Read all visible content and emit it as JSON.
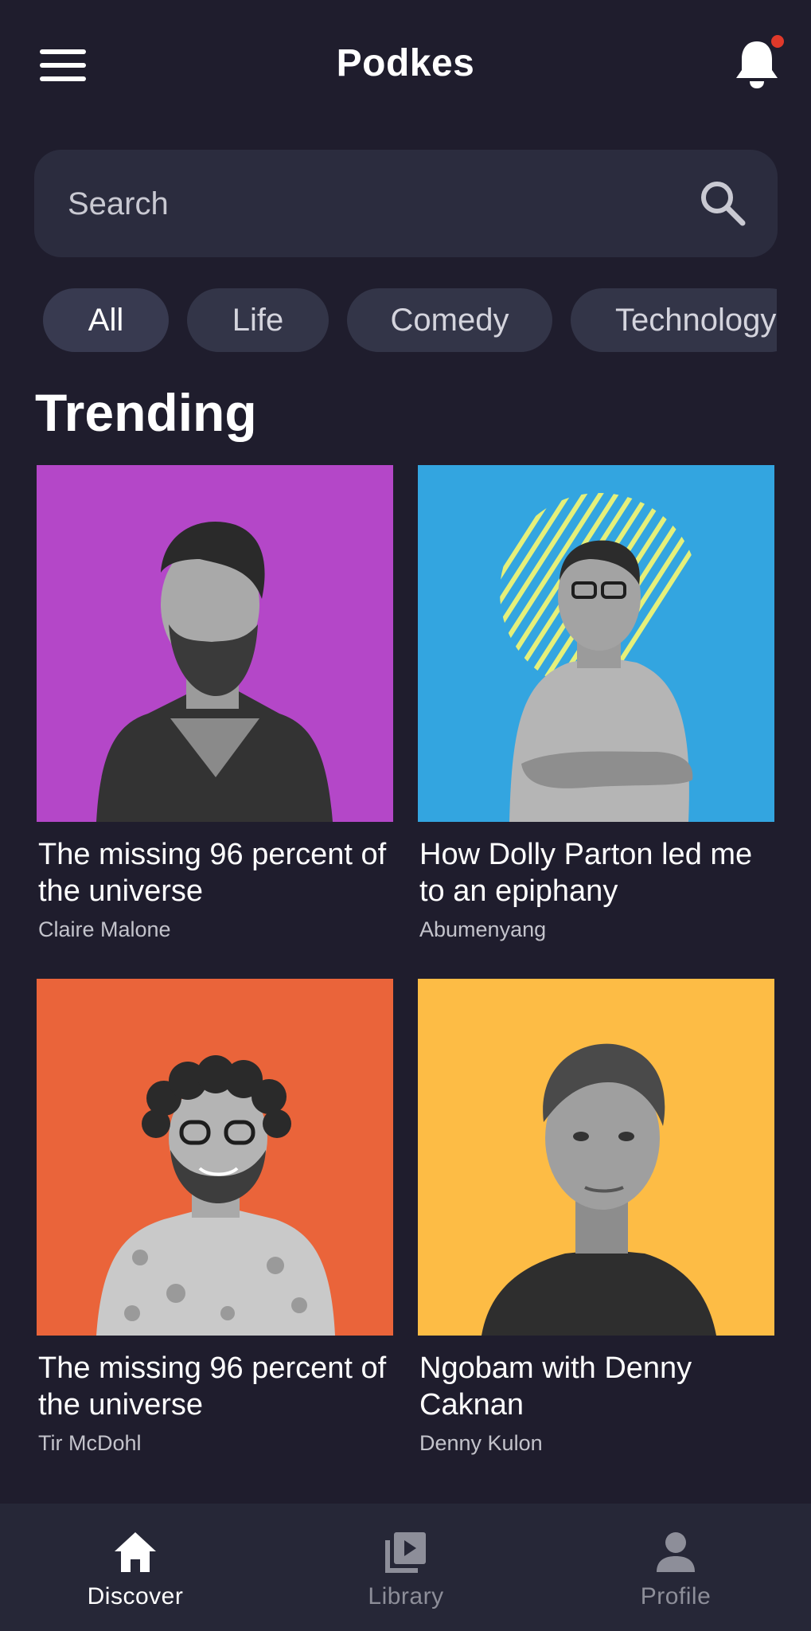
{
  "header": {
    "title": "Podkes",
    "notification_badge_color": "#e0392a"
  },
  "search": {
    "placeholder": "Search"
  },
  "categories": [
    {
      "label": "All",
      "selected": true
    },
    {
      "label": "Life",
      "selected": false
    },
    {
      "label": "Comedy",
      "selected": false
    },
    {
      "label": "Technology",
      "selected": false
    }
  ],
  "trending": {
    "heading": "Trending",
    "items": [
      {
        "title": "The missing 96 percent of the universe",
        "author": "Claire Malone",
        "bg_color": "#b447c8"
      },
      {
        "title": "How Dolly Parton led me to an epiphany",
        "author": "Abumenyang",
        "bg_color": "#33a5e0"
      },
      {
        "title": "The missing 96 percent of the universe",
        "author": "Tir McDohl",
        "bg_color": "#ea643a"
      },
      {
        "title": "Ngobam with Denny Caknan",
        "author": "Denny Kulon",
        "bg_color": "#fdbc45"
      }
    ]
  },
  "bottom_nav": [
    {
      "label": "Discover",
      "icon": "home-icon",
      "active": true
    },
    {
      "label": "Library",
      "icon": "library-icon",
      "active": false
    },
    {
      "label": "Profile",
      "icon": "person-icon",
      "active": false
    }
  ],
  "colors": {
    "background": "#1f1d2d",
    "surface": "#2b2c3e",
    "nav_background": "#262737",
    "active_nav": "#ffffff",
    "inactive_nav": "#8d8e99"
  }
}
